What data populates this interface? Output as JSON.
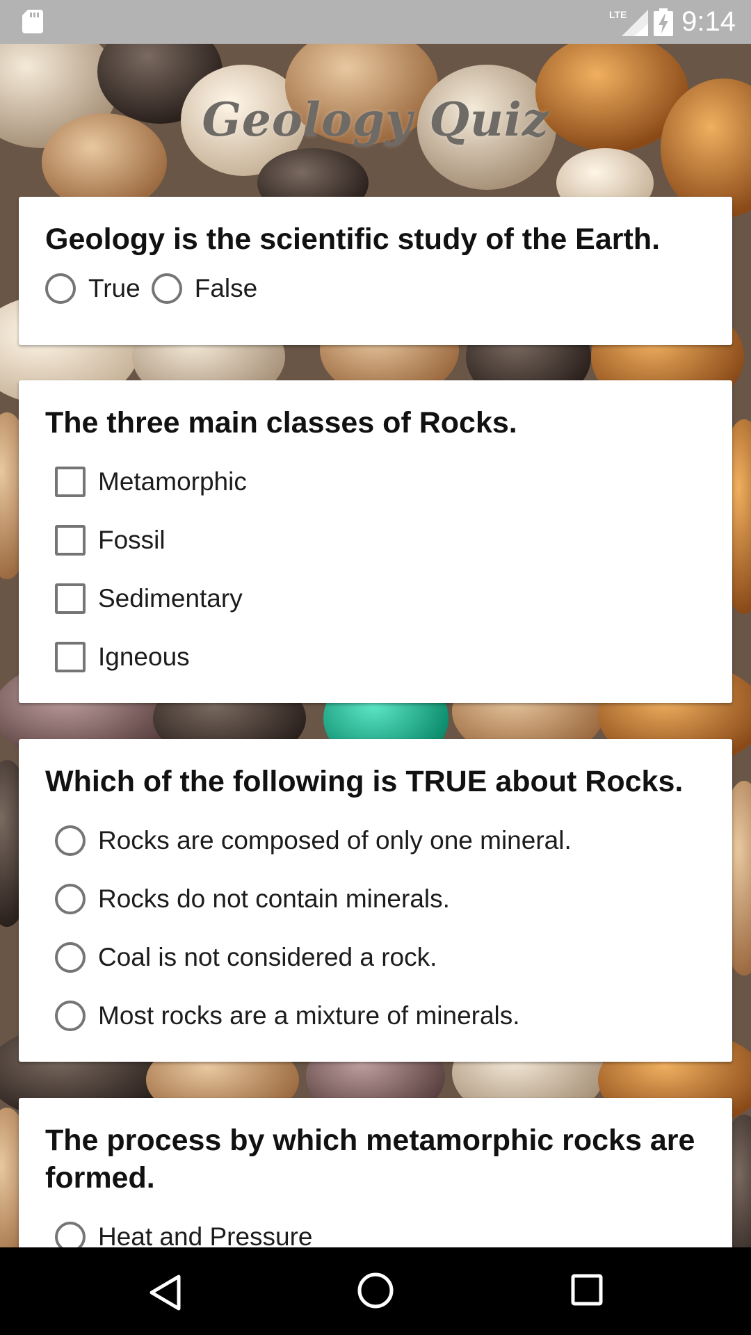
{
  "status_bar": {
    "time": "9:14",
    "network": "LTE",
    "icons": [
      "sd-card-icon",
      "lte-signal-icon",
      "battery-charging-icon"
    ]
  },
  "app": {
    "title": "Geology Quiz"
  },
  "questions": [
    {
      "text": "Geology is the scientific study of the Earth.",
      "type": "radio",
      "options": [
        "True",
        "False"
      ]
    },
    {
      "text": "The three main classes of Rocks.",
      "type": "checkbox",
      "options": [
        "Metamorphic",
        "Fossil",
        "Sedimentary",
        "Igneous"
      ]
    },
    {
      "text": "Which of the following is TRUE about Rocks.",
      "type": "radio",
      "options": [
        "Rocks are composed of only one mineral.",
        "Rocks do not contain minerals.",
        "Coal is not considered a rock.",
        "Most rocks are a mixture of minerals."
      ]
    },
    {
      "text": "The process by which metamorphic rocks are formed.",
      "type": "radio",
      "options": [
        "Heat and Pressure"
      ]
    }
  ],
  "nav_bar": {
    "icons": [
      "back-icon",
      "home-icon",
      "recents-icon"
    ]
  }
}
